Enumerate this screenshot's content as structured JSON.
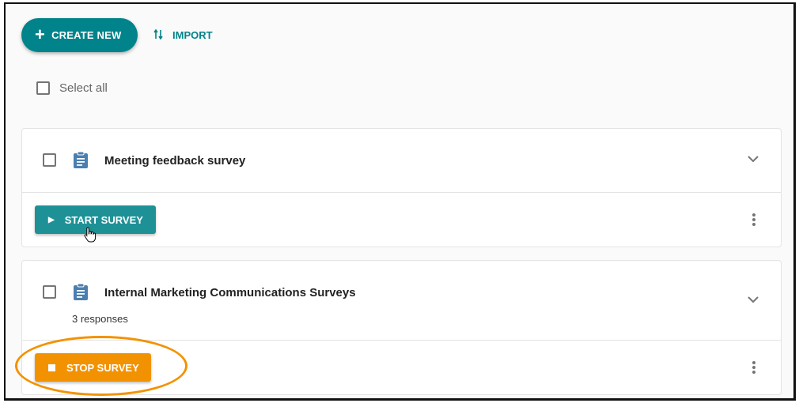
{
  "toolbar": {
    "create_label": "CREATE NEW",
    "create_icon": "plus-icon",
    "import_label": "IMPORT",
    "import_icon": "import-arrows-icon"
  },
  "select_all": {
    "label": "Select all",
    "checked": false
  },
  "surveys": [
    {
      "title": "Meeting feedback survey",
      "icon": "clipboard-icon",
      "subtitle": "",
      "checked": false,
      "action": {
        "label": "START SURVEY",
        "icon": "play-icon",
        "color": "#1e9197"
      }
    },
    {
      "title": "Internal Marketing Communications Surveys",
      "icon": "clipboard-icon",
      "subtitle": "3 responses",
      "checked": false,
      "action": {
        "label": "STOP SURVEY",
        "icon": "stop-icon",
        "color": "#f39200"
      }
    }
  ],
  "colors": {
    "primary": "#00838a",
    "start": "#1e9197",
    "stop": "#f39200",
    "clipboard_icon": "#4a7fb0",
    "highlight": "#f39200"
  },
  "icons": {
    "play": "▶",
    "arrows": "⇅"
  }
}
